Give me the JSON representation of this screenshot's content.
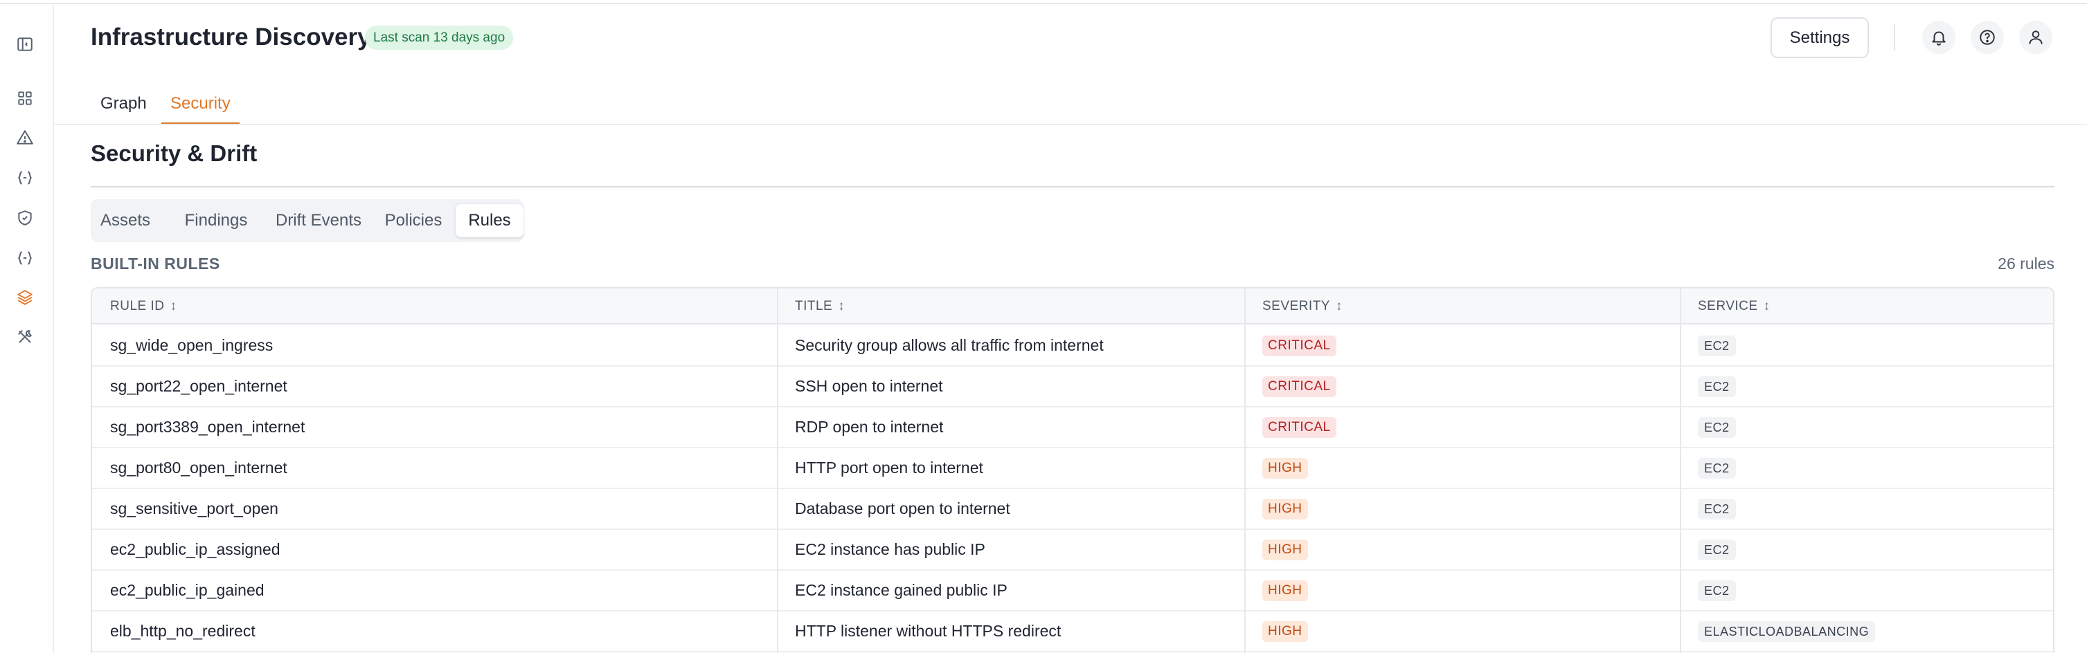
{
  "header": {
    "title": "Infrastructure Discovery",
    "scan_badge": "Last scan 13 days ago",
    "settings_label": "Settings"
  },
  "sidebar": {
    "items": [
      {
        "icon": "panel-toggle-icon"
      },
      {
        "icon": "dashboard-grid-icon"
      },
      {
        "icon": "alert-triangle-icon"
      },
      {
        "icon": "code-braces-icon"
      },
      {
        "icon": "shield-check-icon"
      },
      {
        "icon": "code-braces-icon"
      },
      {
        "icon": "layers-icon",
        "active": true
      },
      {
        "icon": "tools-icon"
      }
    ]
  },
  "tabs": [
    {
      "label": "Graph"
    },
    {
      "label": "Security",
      "active": true
    }
  ],
  "section": {
    "title": "Security & Drift",
    "subtabs": [
      {
        "label": "Assets"
      },
      {
        "label": "Findings"
      },
      {
        "label": "Drift Events"
      },
      {
        "label": "Policies"
      },
      {
        "label": "Rules",
        "active": true
      }
    ]
  },
  "rules": {
    "heading": "BUILT-IN RULES",
    "count": "26 rules",
    "columns": [
      "RULE ID",
      "TITLE",
      "SEVERITY",
      "SERVICE"
    ],
    "sort_glyph": "↕",
    "rows": [
      {
        "id": "sg_wide_open_ingress",
        "title": "Security group allows all traffic from internet",
        "severity": "CRITICAL",
        "service": "EC2"
      },
      {
        "id": "sg_port22_open_internet",
        "title": "SSH open to internet",
        "severity": "CRITICAL",
        "service": "EC2"
      },
      {
        "id": "sg_port3389_open_internet",
        "title": "RDP open to internet",
        "severity": "CRITICAL",
        "service": "EC2"
      },
      {
        "id": "sg_port80_open_internet",
        "title": "HTTP port open to internet",
        "severity": "HIGH",
        "service": "EC2"
      },
      {
        "id": "sg_sensitive_port_open",
        "title": "Database port open to internet",
        "severity": "HIGH",
        "service": "EC2"
      },
      {
        "id": "ec2_public_ip_assigned",
        "title": "EC2 instance has public IP",
        "severity": "HIGH",
        "service": "EC2"
      },
      {
        "id": "ec2_public_ip_gained",
        "title": "EC2 instance gained public IP",
        "severity": "HIGH",
        "service": "EC2"
      },
      {
        "id": "elb_http_no_redirect",
        "title": "HTTP listener without HTTPS redirect",
        "severity": "HIGH",
        "service": "ELASTICLOADBALANCING"
      }
    ]
  },
  "colors": {
    "accent": "#e07828",
    "critical_bg": "#fbe3e3",
    "critical_fg": "#b42121",
    "high_bg": "#fde8da",
    "high_fg": "#c24a12",
    "badge_bg": "#dff5e6",
    "badge_fg": "#1d7a45"
  }
}
